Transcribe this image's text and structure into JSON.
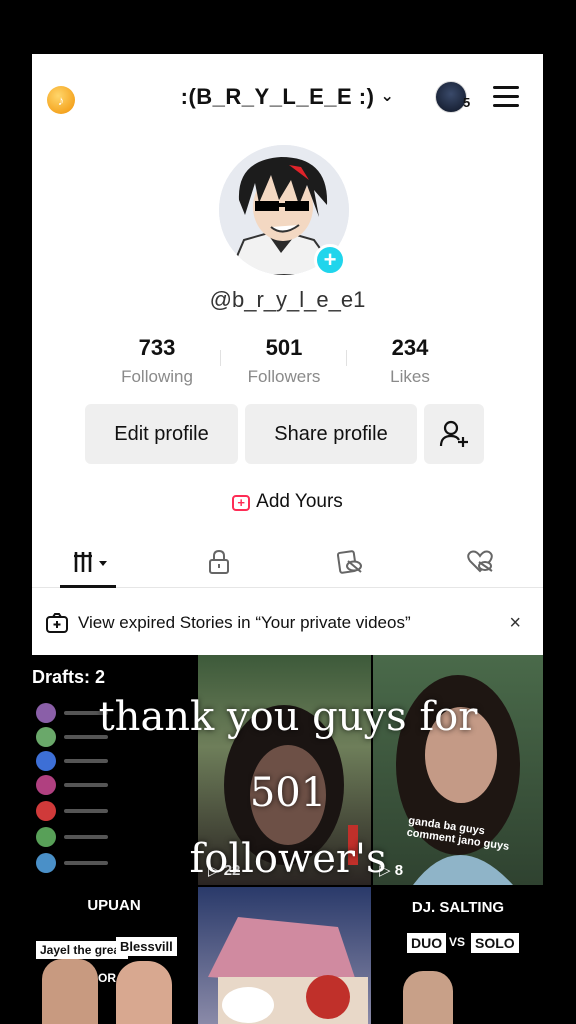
{
  "header": {
    "username": ":(B_R_Y_L_E_E :)",
    "chevron": "⌄",
    "coin_icon": "tiktok-coin-icon",
    "notification_count": "5",
    "menu_icon": "hamburger-menu-icon"
  },
  "profile": {
    "handle": "@b_r_y_l_e_e1",
    "avatar_icon": "profile-avatar",
    "stats": [
      {
        "value": "733",
        "label": "Following"
      },
      {
        "value": "501",
        "label": "Followers"
      },
      {
        "value": "234",
        "label": "Likes"
      }
    ]
  },
  "actions": {
    "edit_label": "Edit profile",
    "share_label": "Share profile",
    "add_friend_icon": "add-friend-icon"
  },
  "add_yours": {
    "label": "Add Yours"
  },
  "tabs": [
    {
      "icon": "grid-videos-icon",
      "active": true
    },
    {
      "icon": "lock-icon"
    },
    {
      "icon": "eye-off-icon"
    },
    {
      "icon": "liked-heart-icon"
    }
  ],
  "banner": {
    "text": "View expired Stories in “Your private videos”",
    "close": "×"
  },
  "grid": {
    "drafts_label": "Drafts: 2",
    "cell2_views": "▷ 22",
    "cell3_views": "▷ 8",
    "cell3_caption": "ganda ba guys comment jano guys",
    "cell4_title": "UPUAN",
    "cell4_tag_left": "Jayel the great",
    "cell4_tag_right": "Blessvill",
    "cell4_or": "OR",
    "cell6_title": "DJ. SALTING",
    "cell6_tag_left": "DUO",
    "cell6_vs": "VS",
    "cell6_tag_right": "SOLO"
  },
  "overlay": {
    "line1": "thank you guys for",
    "line2": "501",
    "line3": "follower's"
  },
  "colors": {
    "accent_pink": "#fe2c55",
    "accent_cyan": "#20d5ec",
    "button_bg": "#efefef"
  }
}
